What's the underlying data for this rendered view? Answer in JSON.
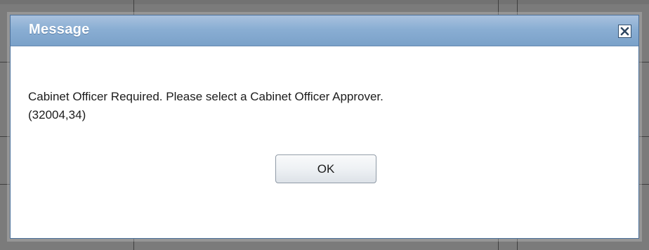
{
  "dialog": {
    "title": "Message",
    "close_icon": "close-icon",
    "message_line1": "Cabinet Officer Required.  Please select a Cabinet Officer Approver.",
    "message_line2": "(32004,34)",
    "ok_label": "OK"
  },
  "colors": {
    "titlebar": "#8aaed3",
    "overlay": "#7b7b7b",
    "dialog_bg": "#ffffff"
  }
}
